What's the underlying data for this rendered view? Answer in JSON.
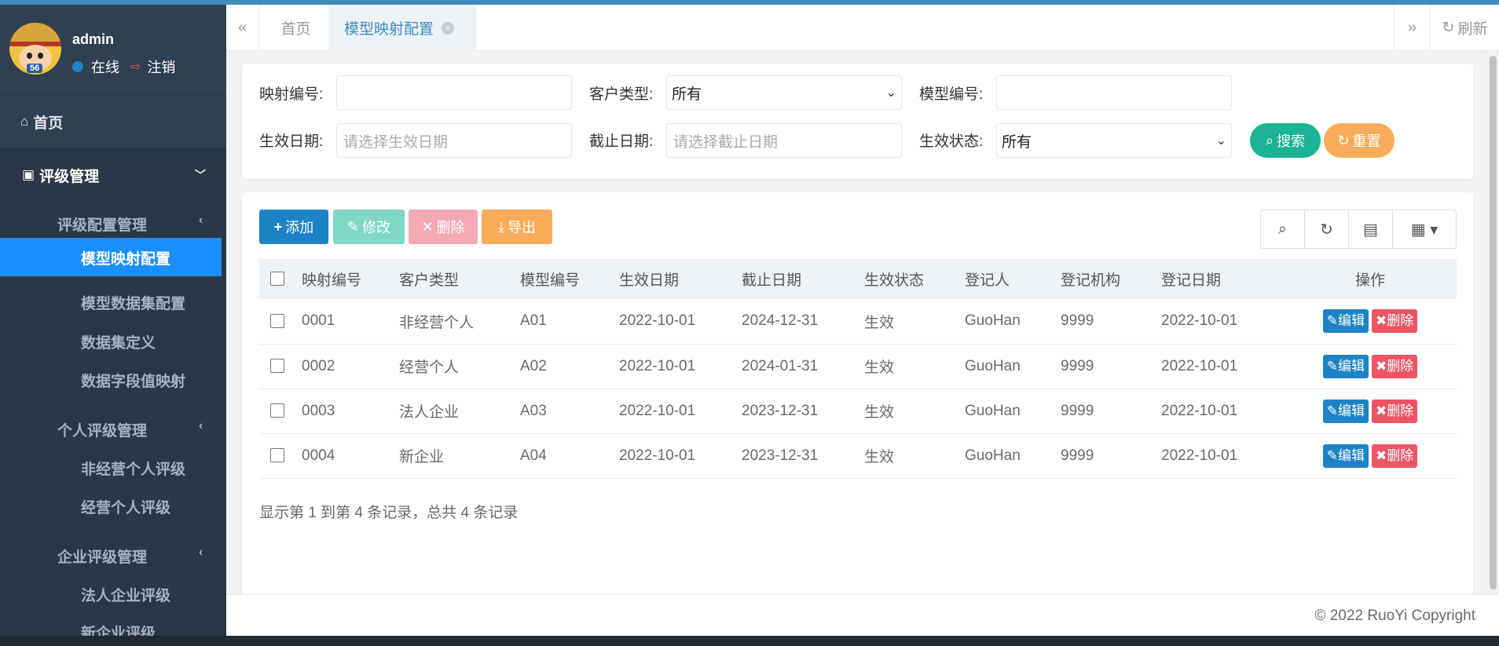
{
  "user": {
    "name": "admin",
    "status": "在线",
    "logout": "注销",
    "avatar_number": "56"
  },
  "sidebar": {
    "home": "首页",
    "rating_menu": "评级管理",
    "groups": [
      {
        "label": "评级配置管理",
        "items": [
          "模型映射配置",
          "模型数据集配置",
          "数据集定义",
          "数据字段值映射"
        ]
      },
      {
        "label": "个人评级管理",
        "items": [
          "非经营个人评级",
          "经营个人评级"
        ]
      },
      {
        "label": "企业评级管理",
        "items": [
          "法人企业评级",
          "新企业评级"
        ]
      }
    ],
    "active_item": "模型映射配置"
  },
  "tabs": {
    "home": "首页",
    "active": "模型映射配置",
    "refresh": "刷新"
  },
  "search": {
    "mapping_no_label": "映射编号:",
    "mapping_no_value": "",
    "customer_type_label": "客户类型:",
    "customer_type_value": "所有",
    "model_no_label": "模型编号:",
    "model_no_value": "",
    "effective_date_label": "生效日期:",
    "effective_date_placeholder": "请选择生效日期",
    "end_date_label": "截止日期:",
    "end_date_placeholder": "请选择截止日期",
    "status_label": "生效状态:",
    "status_value": "所有",
    "search_btn": "搜索",
    "reset_btn": "重置"
  },
  "toolbar": {
    "add": "添加",
    "edit": "修改",
    "delete": "删除",
    "export": "导出"
  },
  "table": {
    "columns": [
      "映射编号",
      "客户类型",
      "模型编号",
      "生效日期",
      "截止日期",
      "生效状态",
      "登记人",
      "登记机构",
      "登记日期",
      "操作"
    ],
    "rows": [
      [
        "0001",
        "非经营个人",
        "A01",
        "2022-10-01",
        "2024-12-31",
        "生效",
        "GuoHan",
        "9999",
        "2022-10-01"
      ],
      [
        "0002",
        "经营个人",
        "A02",
        "2022-10-01",
        "2024-01-31",
        "生效",
        "GuoHan",
        "9999",
        "2022-10-01"
      ],
      [
        "0003",
        "法人企业",
        "A03",
        "2022-10-01",
        "2023-12-31",
        "生效",
        "GuoHan",
        "9999",
        "2022-10-01"
      ],
      [
        "0004",
        "新企业",
        "A04",
        "2022-10-01",
        "2023-12-31",
        "生效",
        "GuoHan",
        "9999",
        "2022-10-01"
      ]
    ],
    "row_edit": "编辑",
    "row_delete": "删除"
  },
  "pagination_info": "显示第 1 到第 4 条记录，总共 4 条记录",
  "footer": "© 2022 RuoYi Copyright",
  "colors": {
    "primary": "#1c84c6",
    "sidebar": "#2f4050",
    "active": "#1a90ff",
    "success": "#1ab394",
    "warning": "#f8ac59",
    "danger": "#ed5565"
  }
}
